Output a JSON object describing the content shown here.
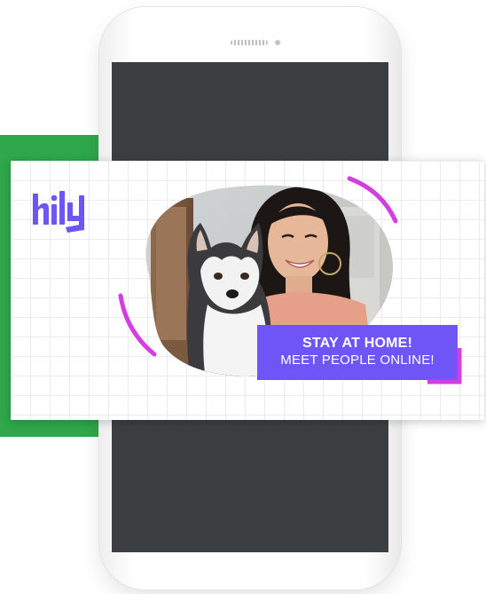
{
  "brand": {
    "logo_text": "hily",
    "accent_purple": "#6f55f5",
    "accent_magenta": "#d23ee0",
    "green": "#2ea84a"
  },
  "phone": {
    "screen_color": "#3b3f41"
  },
  "promo": {
    "headline": "STAY AT HOME!",
    "subline": "MEET PEOPLE ONLINE!",
    "photo_description": "woman-with-husky"
  }
}
